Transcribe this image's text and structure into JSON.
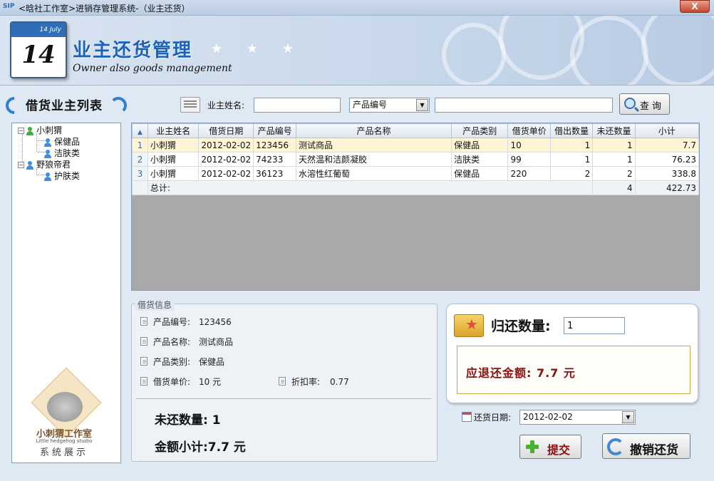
{
  "window": {
    "app_icon": "SIP",
    "title": "<晗社工作室>进销存管理系统-（业主还货）",
    "close_label": "X"
  },
  "banner": {
    "calendar_month": "14 July",
    "calendar_day": "14",
    "title": "业主还货管理",
    "stars": "★ ★ ★",
    "subtitle": "Owner also goods management"
  },
  "sidebar": {
    "title": "借货业主列表",
    "tree": [
      {
        "label": "小刺猬",
        "level": 0,
        "icon": "person-green-icon",
        "expander": "−"
      },
      {
        "label": "保健品",
        "level": 1,
        "icon": "person-blue-icon"
      },
      {
        "label": "洁肤类",
        "level": 1,
        "icon": "person-blue-icon"
      },
      {
        "label": "野狼帝君",
        "level": 0,
        "icon": "person-blue-icon",
        "expander": "−"
      },
      {
        "label": "护肤类",
        "level": 1,
        "icon": "person-blue-icon"
      }
    ],
    "mascot": {
      "name": "小刺猬工作室",
      "en": "Little hedgehog studio",
      "tagline": "系统展示"
    }
  },
  "search": {
    "owner_label": "业主姓名:",
    "owner_value": "",
    "field_select": "产品编号",
    "keyword_value": "",
    "query_label": "查询"
  },
  "grid": {
    "columns": [
      "业主姓名",
      "借货日期",
      "产品编号",
      "产品名称",
      "产品类别",
      "借货单价",
      "借出数量",
      "未还数量",
      "小计"
    ],
    "rows": [
      {
        "rn": "1",
        "owner": "小刺猬",
        "date": "2012-02-02",
        "code": "123456",
        "name": "测试商品",
        "category": "保健品",
        "price": "10",
        "lent": "1",
        "unreturned": "1",
        "subtotal": "7.7"
      },
      {
        "rn": "2",
        "owner": "小刺猬",
        "date": "2012-02-02",
        "code": "74233",
        "name": "天然温和洁颜凝胶",
        "category": "洁肤类",
        "price": "99",
        "lent": "1",
        "unreturned": "1",
        "subtotal": "76.23"
      },
      {
        "rn": "3",
        "owner": "小刺猬",
        "date": "2012-02-02",
        "code": "36123",
        "name": "水溶性红葡萄",
        "category": "保健品",
        "price": "220",
        "lent": "2",
        "unreturned": "2",
        "subtotal": "338.8"
      }
    ],
    "total_label": "总计:",
    "total_unreturned": "4",
    "total_subtotal": "422.73"
  },
  "info": {
    "legend": "借货信息",
    "code_label": "产品编号:",
    "code_value": "123456",
    "name_label": "产品名称:",
    "name_value": "测试商品",
    "category_label": "产品类别:",
    "category_value": "保健品",
    "price_label": "借货单价:",
    "price_value": "10 元",
    "discount_label": "折扣率:",
    "discount_value": "0.77",
    "unreturned_text": "未还数量: 1",
    "amount_text": "金额小计:7.7 元"
  },
  "return": {
    "qty_label": "归还数量:",
    "qty_value": "1",
    "refund_text": "应退还金额: 7.7 元",
    "date_label": "还货日期:",
    "date_value": "2012-02-02",
    "submit_label": "提交",
    "undo_label": "撤销还货"
  }
}
